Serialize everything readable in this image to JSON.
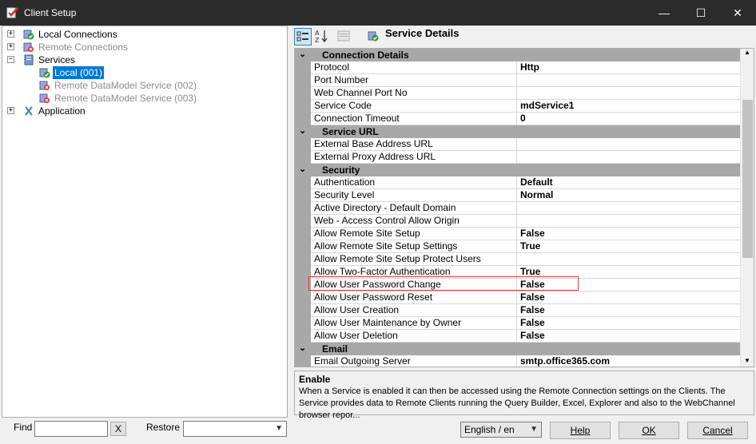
{
  "window": {
    "title": "Client Setup",
    "minimize": "—",
    "maximize": "☐",
    "close": "✕"
  },
  "tree": {
    "items": [
      {
        "label": "Local Connections",
        "expander": "+",
        "icon": "local-connections-icon",
        "dim": false
      },
      {
        "label": "Remote Connections",
        "expander": "+",
        "icon": "remote-connections-icon",
        "dim": true
      },
      {
        "label": "Services",
        "expander": "−",
        "icon": "services-icon",
        "dim": false
      },
      {
        "label": "Local (001)",
        "expander": "",
        "icon": "service-enabled-icon",
        "dim": false,
        "selected": true
      },
      {
        "label": "Remote DataModel Service (002)",
        "expander": "",
        "icon": "service-disabled-icon",
        "dim": true
      },
      {
        "label": "Remote DataModel Service (003)",
        "expander": "",
        "icon": "service-disabled-icon",
        "dim": true
      },
      {
        "label": "Application",
        "expander": "+",
        "icon": "application-icon",
        "dim": false
      }
    ]
  },
  "find": {
    "label": "Find",
    "value": "",
    "clear": "X"
  },
  "restore": {
    "label": "Restore",
    "value": ""
  },
  "toolbar": {
    "title": "Service Details",
    "categorized_icon": "categorized-icon",
    "alpha_icon": "alphabetical-sort-icon",
    "pages_icon": "property-pages-icon",
    "service_icon": "service-enabled-icon"
  },
  "grid": {
    "rows": [
      {
        "type": "cat",
        "label": "Connection Details",
        "exp": "⌄"
      },
      {
        "type": "prop",
        "name": "Protocol",
        "value": "Http"
      },
      {
        "type": "prop",
        "name": "Port Number",
        "value": ""
      },
      {
        "type": "prop",
        "name": "Web Channel Port No",
        "value": ""
      },
      {
        "type": "prop",
        "name": "Service Code",
        "value": "mdService1"
      },
      {
        "type": "prop",
        "name": "Connection Timeout",
        "value": "0"
      },
      {
        "type": "cat",
        "label": "Service URL",
        "exp": "⌄"
      },
      {
        "type": "prop",
        "name": "External Base Address URL",
        "value": ""
      },
      {
        "type": "prop",
        "name": "External Proxy Address URL",
        "value": ""
      },
      {
        "type": "cat",
        "label": "Security",
        "exp": "⌄"
      },
      {
        "type": "prop",
        "name": "Authentication",
        "value": "Default"
      },
      {
        "type": "prop",
        "name": "Security Level",
        "value": "Normal"
      },
      {
        "type": "prop",
        "name": "Active Directory - Default Domain",
        "value": ""
      },
      {
        "type": "prop",
        "name": "Web - Access Control Allow Origin",
        "value": ""
      },
      {
        "type": "prop",
        "name": "Allow Remote Site Setup",
        "value": "False"
      },
      {
        "type": "prop",
        "name": "Allow Remote Site Setup Settings",
        "value": "True"
      },
      {
        "type": "prop",
        "name": "Allow Remote Site Setup Protect Users",
        "value": ""
      },
      {
        "type": "prop",
        "name": "Allow Two-Factor Authentication",
        "value": "True"
      },
      {
        "type": "prop",
        "name": "Allow User Password Change",
        "value": "False"
      },
      {
        "type": "prop",
        "name": "Allow User Password Reset",
        "value": "False"
      },
      {
        "type": "prop",
        "name": "Allow User Creation",
        "value": "False"
      },
      {
        "type": "prop",
        "name": "Allow User Maintenance by Owner",
        "value": "False"
      },
      {
        "type": "prop",
        "name": "Allow User Deletion",
        "value": "False"
      },
      {
        "type": "cat",
        "label": "Email",
        "exp": "⌄"
      },
      {
        "type": "prop",
        "name": "Email Outgoing Server",
        "value": "smtp.office365.com"
      }
    ],
    "scroll_up": "▲",
    "scroll_down": "▼"
  },
  "help": {
    "title": "Enable",
    "text": "When a Service is enabled it can then be accessed using the Remote Connection settings on the Clients. The Service provides data to Remote Clients running the Query Builder, Excel, Explorer and also to the WebChannel browser repor..."
  },
  "footer": {
    "language": "English / en",
    "help": "Help",
    "ok": "OK",
    "cancel": "Cancel"
  },
  "colors": {
    "titlebar": "#2b2b2b",
    "selection": "#0078d7",
    "category": "#a8a8a8",
    "highlight": "#e53935"
  }
}
